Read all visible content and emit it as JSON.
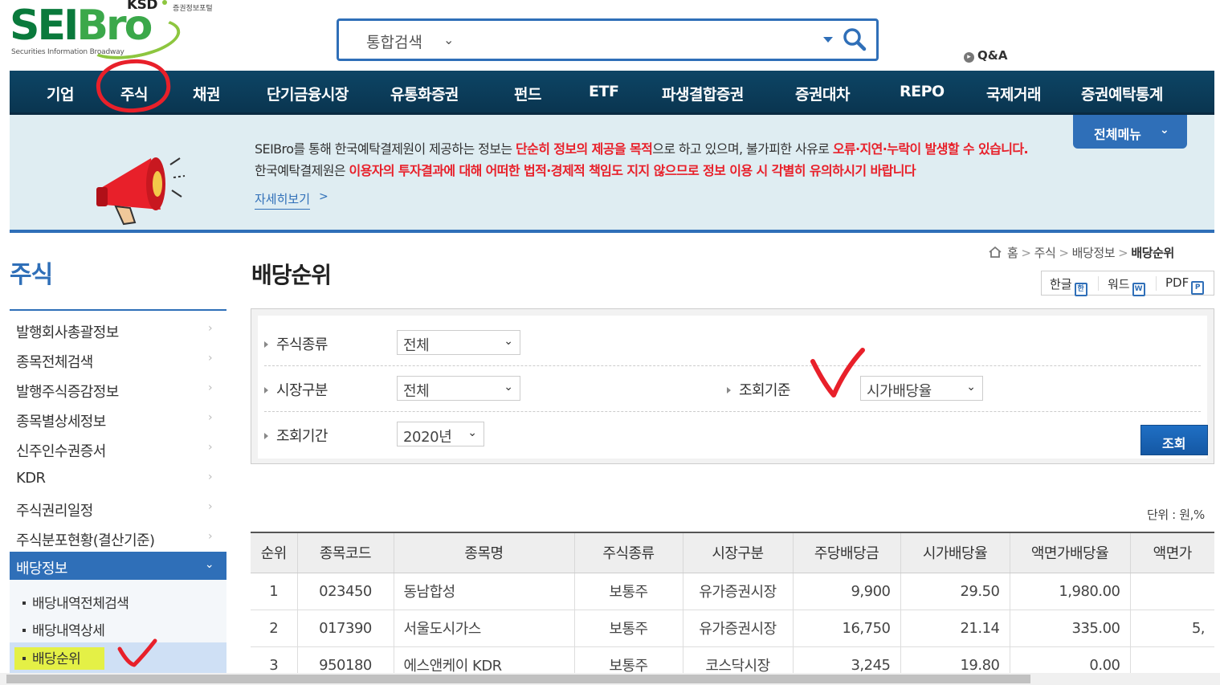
{
  "logo": {
    "ksd": "KSD",
    "ksd_sub": "증권정보포털",
    "brand_a": "SEI",
    "brand_b": "Bro",
    "tagline": "Securities Information Broadway"
  },
  "search": {
    "category": "통합검색",
    "placeholder": ""
  },
  "qna": "Q&A",
  "nav": {
    "items": [
      "기업",
      "주식",
      "채권",
      "단기금융시장",
      "유통화증권",
      "펀드",
      "ETF",
      "파생결합증권",
      "증권대차",
      "REPO",
      "국제거래",
      "증권예탁통계"
    ]
  },
  "notice": {
    "line1_a": "SEIBro를 통해 한국예탁결제원이 제공하는 정보는 ",
    "line1_b": "단순히 정보의 제공을 목적",
    "line1_c": "으로 하고 있으며, 불가피한 사유로 ",
    "line1_d": "오류·지연·누락이 발생할 수 있습니다.",
    "line2_a": "한국예탁결제원은 ",
    "line2_b": "이용자의 투자결과에 대해 어떠한 법적·경제적 책임도 지지 않으므로 정보 이용 시 각별히 유의하시기 바랍니다",
    "more": "자세히보기",
    "more_arrow": ">",
    "all_menu": "전체메뉴"
  },
  "sidebar": {
    "title": "주식",
    "items": [
      {
        "label": "발행회사총괄정보"
      },
      {
        "label": "종목전체검색"
      },
      {
        "label": "발행주식증감정보"
      },
      {
        "label": "종목별상세정보"
      },
      {
        "label": "신주인수권증서"
      },
      {
        "label": "KDR"
      },
      {
        "label": "주식권리일정"
      },
      {
        "label": "주식분포현황(결산기준)"
      }
    ],
    "active": "배당정보",
    "sub_items": [
      {
        "label": "배당내역전체검색"
      },
      {
        "label": "배당내역상세"
      },
      {
        "label": "배당순위"
      }
    ]
  },
  "main": {
    "title": "배당순위",
    "breadcrumb": [
      "홈",
      "주식",
      "배당정보",
      "배당순위"
    ],
    "exports": [
      "한글",
      "워드",
      "PDF"
    ]
  },
  "filter": {
    "stock_type_label": "주식종류",
    "stock_type_value": "전체",
    "market_label": "시장구분",
    "market_value": "전체",
    "criteria_label": "조회기준",
    "criteria_value": "시가배당율",
    "period_label": "조회기간",
    "period_value": "2020년",
    "search_button": "조회"
  },
  "unit": "단위 : 원,%",
  "table": {
    "headers": [
      "순위",
      "종목코드",
      "종목명",
      "주식종류",
      "시장구분",
      "주당배당금",
      "시가배당율",
      "액면가배당율",
      "액면가"
    ],
    "rows": [
      [
        "1",
        "023450",
        "동남합성",
        "보통주",
        "유가증권시장",
        "9,900",
        "29.50",
        "1,980.00",
        ""
      ],
      [
        "2",
        "017390",
        "서울도시가스",
        "보통주",
        "유가증권시장",
        "16,750",
        "21.14",
        "335.00",
        "5,"
      ],
      [
        "3",
        "950180",
        "에스앤케이 KDR",
        "보통주",
        "코스닥시장",
        "3,245",
        "19.80",
        "0.00",
        ""
      ]
    ]
  },
  "colors": {
    "nav_bg": "#0d4565",
    "accent_blue": "#2f6fb8",
    "warning_red": "#e8202a",
    "highlighter": "#e6f233"
  }
}
